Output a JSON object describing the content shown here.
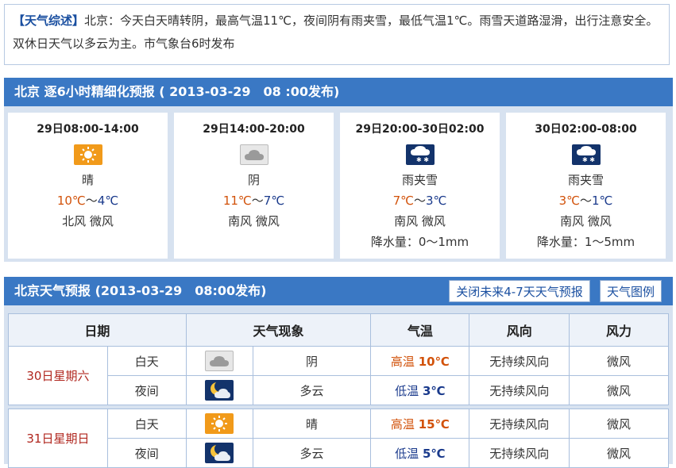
{
  "summary": {
    "tag": "【天气综述】",
    "text": "北京：今天白天晴转阴，最高气温11℃，夜间阴有雨夹雪，最低气温1℃。雨雪天道路湿滑，出行注意安全。双休日天气以多云为主。市气象台6时发布"
  },
  "six_hour": {
    "title": "北京 逐6小时精细化预报 ( 2013-03-29　08 :00发布)",
    "cards": [
      {
        "time": "29日08:00-14:00",
        "icon": "sun-icon",
        "weather": "晴",
        "high": "10℃",
        "sep": "～",
        "low": "4℃",
        "wind": "北风 微风",
        "precip": ""
      },
      {
        "time": "29日14:00-20:00",
        "icon": "cloud-icon",
        "weather": "阴",
        "high": "11℃",
        "sep": "～",
        "low": "7℃",
        "wind": "南风 微风",
        "precip": ""
      },
      {
        "time": "29日20:00-30日02:00",
        "icon": "sleet-icon",
        "weather": "雨夹雪",
        "high": "7℃",
        "sep": "～",
        "low": "3℃",
        "wind": "南风 微风",
        "precip": "降水量：0～1mm"
      },
      {
        "time": "30日02:00-08:00",
        "icon": "sleet-icon",
        "weather": "雨夹雪",
        "high": "3℃",
        "sep": "～",
        "low": "1℃",
        "wind": "南风 微风",
        "precip": "降水量：1～5mm"
      }
    ]
  },
  "forecast": {
    "title": "北京天气预报 (2013-03-29　08:00发布)",
    "close_btn": "关闭未来4-7天天气预报",
    "legend_btn": "天气图例",
    "headers": [
      "日期",
      "天气现象",
      "气温",
      "风向",
      "风力"
    ],
    "days": [
      {
        "date": "30日星期六",
        "rows": [
          {
            "period": "白天",
            "icon": "cloud-icon",
            "weather": "阴",
            "temp_label": "高温",
            "temp": "10℃",
            "wind_dir": "无持续风向",
            "wind_force": "微风"
          },
          {
            "period": "夜间",
            "icon": "moon-cloud-icon",
            "weather": "多云",
            "temp_label": "低温",
            "temp": "3℃",
            "wind_dir": "无持续风向",
            "wind_force": "微风"
          }
        ]
      },
      {
        "date": "31日星期日",
        "rows": [
          {
            "period": "白天",
            "icon": "sun-icon",
            "weather": "晴",
            "temp_label": "高温",
            "temp": "15℃",
            "wind_dir": "无持续风向",
            "wind_force": "微风"
          },
          {
            "period": "夜间",
            "icon": "moon-cloud-icon",
            "weather": "多云",
            "temp_label": "低温",
            "temp": "5℃",
            "wind_dir": "无持续风向",
            "wind_force": "微风"
          }
        ]
      }
    ]
  },
  "colors": {
    "header_bar": "#3a78c4",
    "high_temp": "#d2520a",
    "low_temp": "#1a3a8c",
    "date": "#b0261e"
  }
}
